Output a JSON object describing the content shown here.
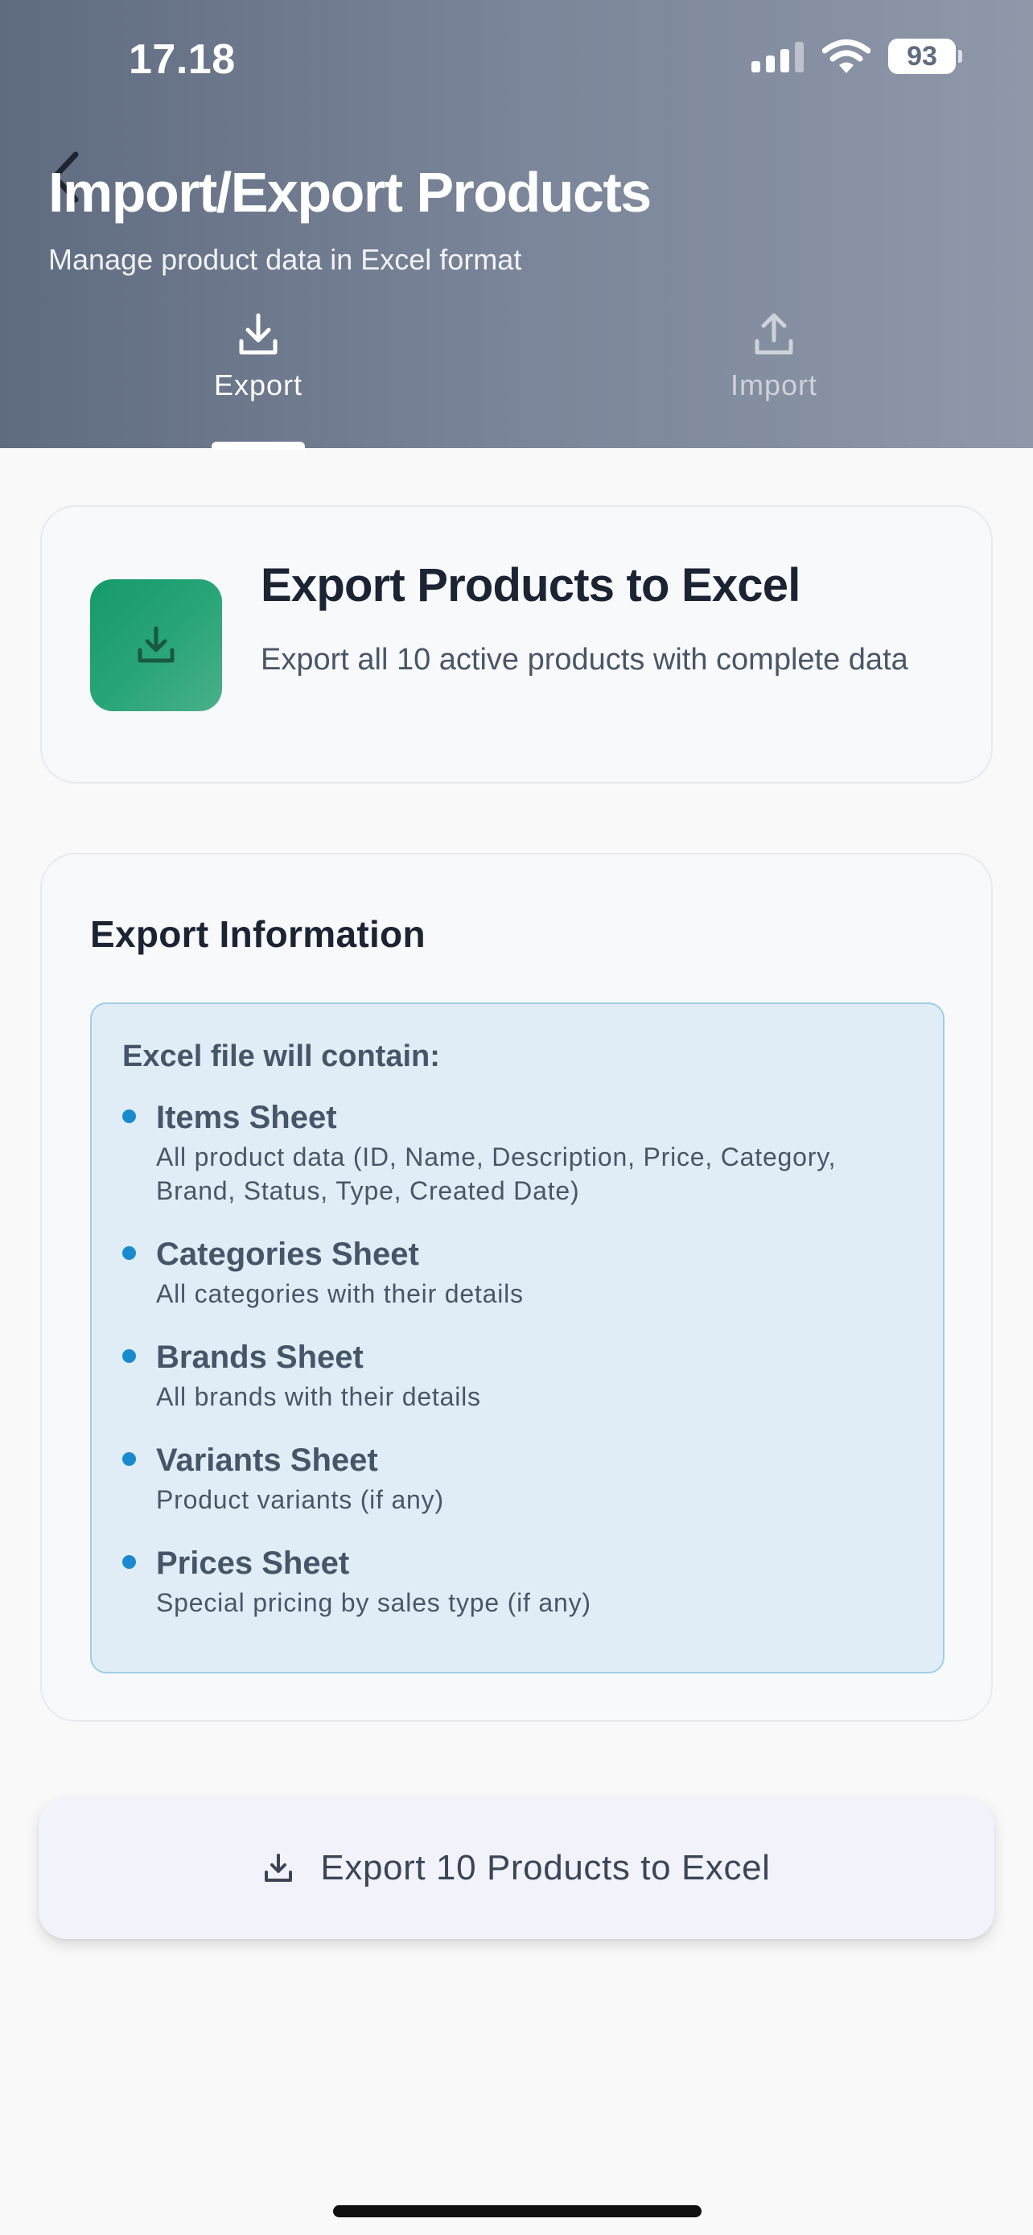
{
  "status_bar": {
    "time": "17.18",
    "battery": "93",
    "icons": [
      "cellular-signal-icon",
      "wifi-icon",
      "battery-icon"
    ]
  },
  "header": {
    "title": "Import/Export Products",
    "subtitle": "Manage product data in Excel format",
    "back_icon": "chevron-left-icon"
  },
  "tabs": [
    {
      "label": "Export",
      "icon": "download-icon",
      "active": true
    },
    {
      "label": "Import",
      "icon": "upload-icon",
      "active": false
    }
  ],
  "export_card": {
    "title": "Export Products to Excel",
    "description": "Export all 10 active products with complete data",
    "icon": "download-icon"
  },
  "info_card": {
    "title": "Export Information",
    "box_heading": "Excel file will contain:",
    "sheets": [
      {
        "name": "Items Sheet",
        "description": "All product data (ID, Name, Description, Price, Category, Brand, Status, Type, Created Date)"
      },
      {
        "name": "Categories Sheet",
        "description": "All categories with their details"
      },
      {
        "name": "Brands Sheet",
        "description": "All brands with their details"
      },
      {
        "name": "Variants Sheet",
        "description": "Product variants (if any)"
      },
      {
        "name": "Prices Sheet",
        "description": "Special pricing by sales type (if any)"
      }
    ]
  },
  "export_button": {
    "label": "Export 10 Products to Excel",
    "icon": "download-icon"
  },
  "colors": {
    "header_gradient_start": "#5f6b80",
    "header_gradient_end": "#8e98a9",
    "accent_green": "#1a9b6c",
    "info_box_background": "#e0edf6",
    "info_box_border": "#9fcfe8",
    "bullet_blue": "#1a8acf"
  }
}
